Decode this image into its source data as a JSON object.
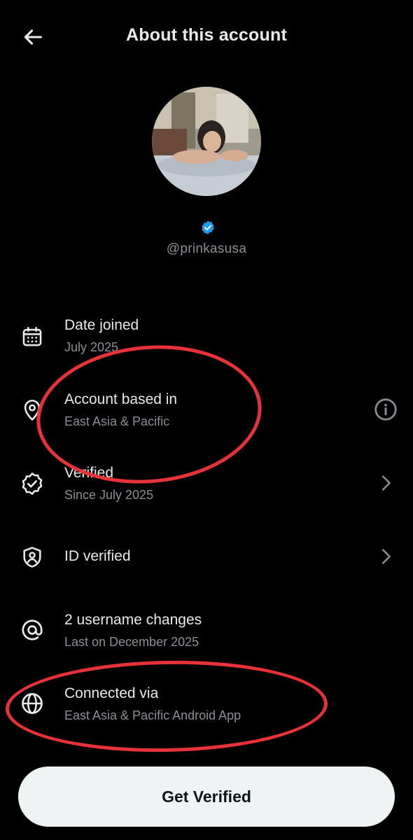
{
  "header": {
    "title": "About this account",
    "back_icon": "arrow-left-icon"
  },
  "profile": {
    "handle": "@prinkasusa",
    "verified_icon": "verified-badge-icon",
    "badge_color": "#1d9bf0"
  },
  "rows": [
    {
      "icon": "calendar-icon",
      "label": "Date joined",
      "sub": "July 2025",
      "trailing": ""
    },
    {
      "icon": "location-pin-icon",
      "label": "Account based in",
      "sub": "East Asia & Pacific",
      "trailing": "info-icon"
    },
    {
      "icon": "verified-check-icon",
      "label": "Verified",
      "sub": "Since July 2025",
      "trailing": "chevron-right-icon"
    },
    {
      "icon": "shield-person-icon",
      "label": "ID verified",
      "sub": "",
      "trailing": "chevron-right-icon"
    },
    {
      "icon": "at-sign-icon",
      "label": "2 username changes",
      "sub": "Last on December 2025",
      "trailing": ""
    },
    {
      "icon": "globe-icon",
      "label": "Connected via",
      "sub": "East Asia & Pacific Android App",
      "trailing": ""
    }
  ],
  "cta": {
    "label": "Get Verified"
  },
  "colors": {
    "background": "#000000",
    "primary_text": "#e7e9ea",
    "secondary_text": "#8b8f94",
    "annotation": "#e8323a",
    "button_bg": "#eff3f4"
  }
}
